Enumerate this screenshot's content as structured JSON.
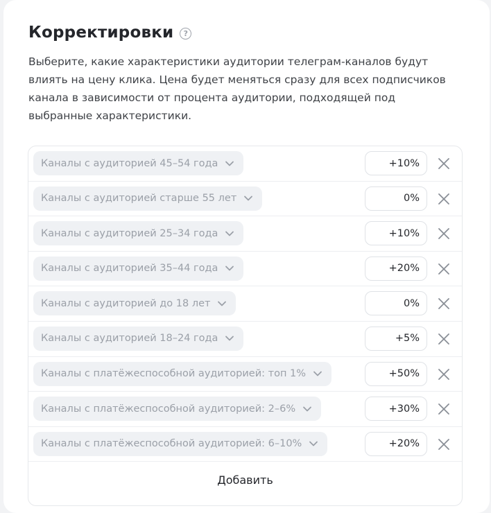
{
  "section": {
    "title": "Корректировки",
    "help_icon": "question-circle-icon",
    "description": "Выберите, какие характеристики аудитории телеграм-каналов будут влиять на цену клика. Цена будет меняться сразу для всех подписчиков канала в зависимости от процента аудитории, подходящей под выбранные характеристики."
  },
  "adjustments": [
    {
      "label": "Каналы с аудиторией 45–54 года",
      "value": "+10%"
    },
    {
      "label": "Каналы с аудиторией старше 55 лет",
      "value": "0%"
    },
    {
      "label": "Каналы с аудиторией 25–34 года",
      "value": "+10%"
    },
    {
      "label": "Каналы с аудиторией 35–44 года",
      "value": "+20%"
    },
    {
      "label": "Каналы с аудиторией до 18 лет",
      "value": "0%"
    },
    {
      "label": "Каналы с аудиторией 18–24 года",
      "value": "+5%"
    },
    {
      "label": "Каналы с платёжеспособной аудиторией: топ 1%",
      "value": "+50%"
    },
    {
      "label": "Каналы с платёжеспособной аудиторией: 2–6%",
      "value": "+30%"
    },
    {
      "label": "Каналы с платёжеспособной аудиторией: 6–10%",
      "value": "+20%"
    }
  ],
  "icons": {
    "chip_dropdown": "chevron-down-icon",
    "remove": "close-icon"
  },
  "add_button_label": "Добавить"
}
